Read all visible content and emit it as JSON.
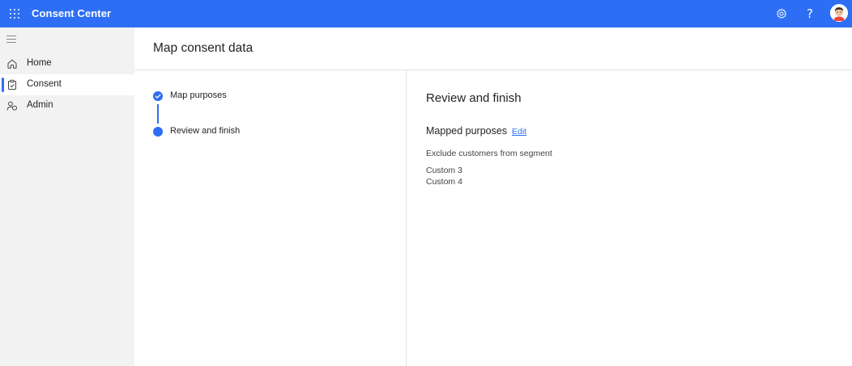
{
  "app": {
    "title": "Consent Center",
    "accent_color": "#2d6ef5",
    "icons": {
      "launcher": "waffle-icon",
      "settings": "gear-icon",
      "help": "question-icon",
      "avatar": "avatar-icon"
    },
    "help_glyph": "?"
  },
  "sidebar": {
    "menu_icon": "hamburger-icon",
    "items": [
      {
        "label": "Home",
        "icon": "home-icon",
        "selected": false
      },
      {
        "label": "Consent",
        "icon": "clipboard-check-icon",
        "selected": true
      },
      {
        "label": "Admin",
        "icon": "people-icon",
        "selected": false
      }
    ]
  },
  "page": {
    "title": "Map consent data"
  },
  "stepper": {
    "steps": [
      {
        "label": "Map purposes",
        "state": "completed"
      },
      {
        "label": "Review and finish",
        "state": "current"
      }
    ]
  },
  "review": {
    "title": "Review and finish",
    "section_title": "Mapped purposes",
    "edit_label": "Edit",
    "segment_label": "Exclude customers from segment",
    "purposes": [
      "Custom 3",
      "Custom 4"
    ]
  }
}
